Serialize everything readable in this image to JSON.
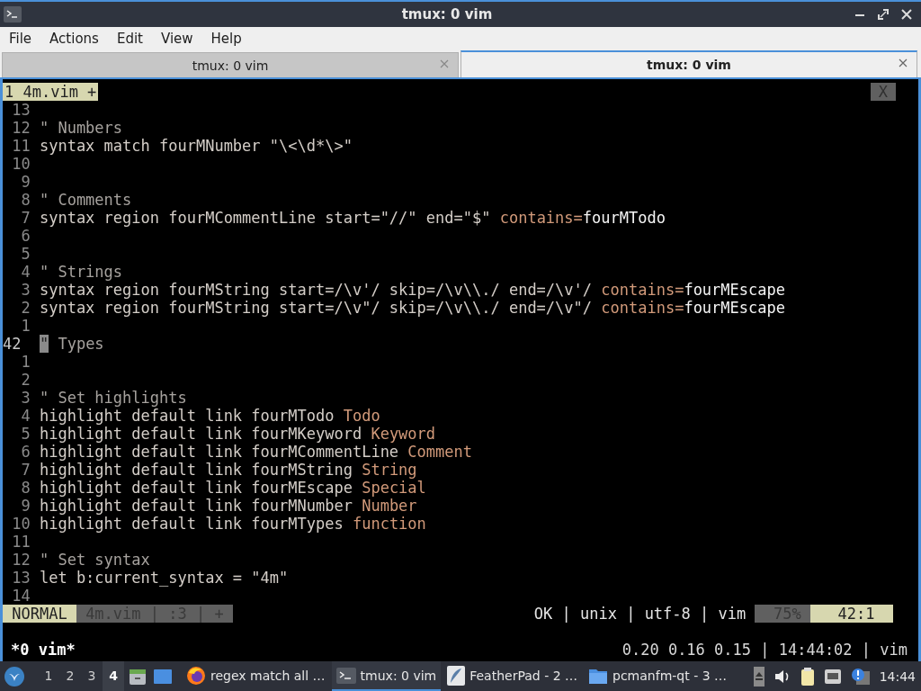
{
  "window": {
    "title": "tmux: 0 vim"
  },
  "menu": [
    "File",
    "Actions",
    "Edit",
    "View",
    "Help"
  ],
  "tabs": [
    {
      "label": "tmux: 0 vim",
      "selected": false
    },
    {
      "label": "tmux: 0 vim",
      "selected": true
    }
  ],
  "terminal": {
    "tabline": {
      "buffer": "1 4m.vim +",
      "close": "X"
    },
    "lines": [
      {
        "number": "13",
        "current": false
      },
      {
        "number": "12",
        "current": false,
        "segments": [
          {
            "text": "\" Numbers",
            "kind": "comment"
          }
        ]
      },
      {
        "number": "11",
        "current": false,
        "segments": [
          {
            "text": "syntax match fourMNumber \"\\<\\d*\\>\"",
            "kind": "plain"
          }
        ]
      },
      {
        "number": "10",
        "current": false
      },
      {
        "number": "9",
        "current": false
      },
      {
        "number": "8",
        "current": false,
        "segments": [
          {
            "text": "\" Comments",
            "kind": "comment"
          }
        ]
      },
      {
        "number": "7",
        "current": false,
        "segments": [
          {
            "text": "syntax region fourMCommentLine start=\"//\" end=\"$\" ",
            "kind": "plain"
          },
          {
            "text": "contains=",
            "kind": "accent"
          },
          {
            "text": "fourMTodo",
            "kind": "bright"
          }
        ]
      },
      {
        "number": "6",
        "current": false
      },
      {
        "number": "5",
        "current": false
      },
      {
        "number": "4",
        "current": false,
        "segments": [
          {
            "text": "\" Strings",
            "kind": "comment"
          }
        ]
      },
      {
        "number": "3",
        "current": false,
        "segments": [
          {
            "text": "syntax region fourMString start=/\\v'/ skip=/\\v\\\\./ end=/\\v'/ ",
            "kind": "plain"
          },
          {
            "text": "contains=",
            "kind": "accent"
          },
          {
            "text": "fourMEscape",
            "kind": "bright"
          }
        ]
      },
      {
        "number": "2",
        "current": false,
        "segments": [
          {
            "text": "syntax region fourMString start=/\\v\"/ skip=/\\v\\\\./ end=/\\v\"/ ",
            "kind": "plain"
          },
          {
            "text": "contains=",
            "kind": "accent"
          },
          {
            "text": "fourMEscape",
            "kind": "bright"
          }
        ]
      },
      {
        "number": "1",
        "current": false
      },
      {
        "number": "42",
        "current": true,
        "segments": [
          {
            "text": "\"",
            "kind": "cursor"
          },
          {
            "text": " Types",
            "kind": "comment"
          }
        ]
      },
      {
        "number": "1",
        "current": false
      },
      {
        "number": "2",
        "current": false
      },
      {
        "number": "3",
        "current": false,
        "segments": [
          {
            "text": "\" Set highlights",
            "kind": "comment"
          }
        ]
      },
      {
        "number": "4",
        "current": false,
        "segments": [
          {
            "text": "highlight default link fourMTodo ",
            "kind": "plain"
          },
          {
            "text": "Todo",
            "kind": "accent"
          }
        ]
      },
      {
        "number": "5",
        "current": false,
        "segments": [
          {
            "text": "highlight default link fourMKeyword ",
            "kind": "plain"
          },
          {
            "text": "Keyword",
            "kind": "accent"
          }
        ]
      },
      {
        "number": "6",
        "current": false,
        "segments": [
          {
            "text": "highlight default link fourMCommentLine ",
            "kind": "plain"
          },
          {
            "text": "Comment",
            "kind": "accent"
          }
        ]
      },
      {
        "number": "7",
        "current": false,
        "segments": [
          {
            "text": "highlight default link fourMString ",
            "kind": "plain"
          },
          {
            "text": "String",
            "kind": "accent"
          }
        ]
      },
      {
        "number": "8",
        "current": false,
        "segments": [
          {
            "text": "highlight default link fourMEscape ",
            "kind": "plain"
          },
          {
            "text": "Special",
            "kind": "accent"
          }
        ]
      },
      {
        "number": "9",
        "current": false,
        "segments": [
          {
            "text": "highlight default link fourMNumber ",
            "kind": "plain"
          },
          {
            "text": "Number",
            "kind": "accent"
          }
        ]
      },
      {
        "number": "10",
        "current": false,
        "segments": [
          {
            "text": "highlight default link fourMTypes ",
            "kind": "plain"
          },
          {
            "text": "function",
            "kind": "accent"
          }
        ]
      },
      {
        "number": "11",
        "current": false
      },
      {
        "number": "12",
        "current": false,
        "segments": [
          {
            "text": "\" Set syntax",
            "kind": "comment"
          }
        ]
      },
      {
        "number": "13",
        "current": false,
        "segments": [
          {
            "text": "let b:current_syntax = \"4m\"",
            "kind": "plain"
          }
        ]
      },
      {
        "number": "14",
        "current": false
      }
    ],
    "statusline": {
      "left": [
        {
          "text": "NORMAL",
          "kind": "mode"
        },
        {
          "text": "4m.vim | :3 | +",
          "kind": "file"
        }
      ],
      "right": [
        {
          "text": "OK | unix | utf-8 | vim",
          "kind": "info"
        },
        {
          "text": "75%",
          "kind": "percent"
        },
        {
          "text": "42:1",
          "kind": "position"
        }
      ]
    },
    "tmux": {
      "window": "*0 vim*",
      "status": "0.20 0.16 0.15 | 14:44:02 | vim"
    }
  },
  "taskbar": {
    "desktops": [
      {
        "label": "1",
        "selected": false
      },
      {
        "label": "2",
        "selected": false
      },
      {
        "label": "3",
        "selected": false
      },
      {
        "label": "4",
        "selected": true
      }
    ],
    "windows": [
      {
        "label": "regex match all …",
        "kind": "browser",
        "selected": false
      },
      {
        "label": "tmux: 0 vim",
        "kind": "terminal",
        "selected": true
      },
      {
        "label": "FeatherPad - 2 …",
        "kind": "feather",
        "selected": false
      },
      {
        "label": "pcmanfm-qt - 3 …",
        "kind": "folder",
        "selected": false
      }
    ],
    "clock": "14:44"
  }
}
